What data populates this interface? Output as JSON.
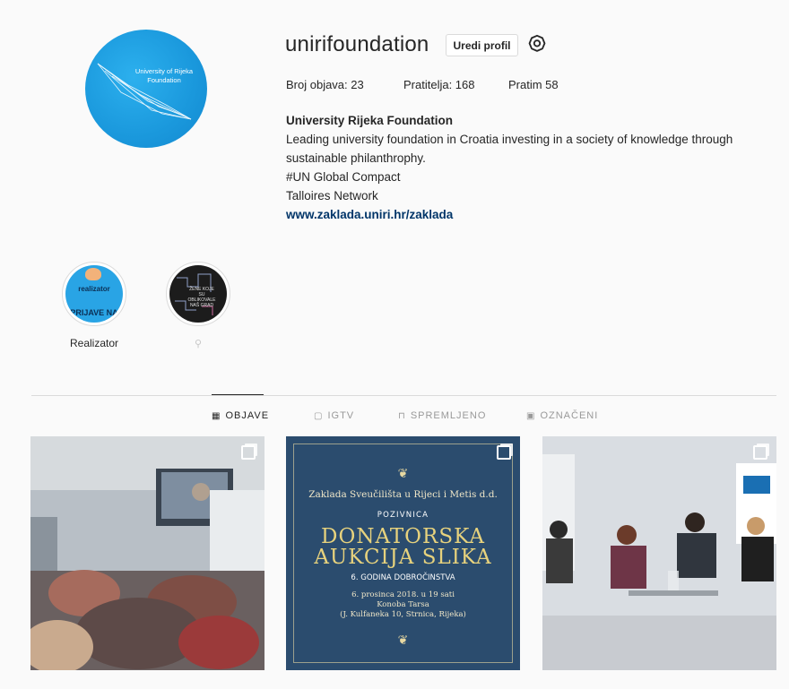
{
  "profile": {
    "username": "unirifoundation",
    "edit_button": "Uredi profil",
    "avatar_text": "University of Rijeka Foundation",
    "stats": {
      "posts": "Broj objava: 23",
      "followers": "Pratitelja: 168",
      "following": "Pratim 58"
    },
    "bio": {
      "name": "University Rijeka Foundation",
      "line1": "Leading university foundation in Croatia investing in a society of knowledge through",
      "line2": "sustainable philanthrophy.",
      "line3": "#UN Global Compact",
      "line4": "Talloires Network",
      "link": "www.zaklada.uniri.hr/zaklada"
    }
  },
  "highlights": [
    {
      "label": "Realizator",
      "img_text_top": "realizator",
      "img_text_bottom": "PRIJAVE NA"
    },
    {
      "label": "",
      "img_text": "ŽENE KOJE SU OBLIKOVALE NAŠ GRAD",
      "pin_icon": "pin-icon"
    }
  ],
  "tabs": [
    {
      "label": "OBJAVE",
      "icon": "grid-icon",
      "active": true
    },
    {
      "label": "IGTV",
      "icon": "tv-icon",
      "active": false
    },
    {
      "label": "SPREMLJENO",
      "icon": "bookmark-icon",
      "active": false
    },
    {
      "label": "OZNAČENI",
      "icon": "tag-icon",
      "active": false
    }
  ],
  "posts": {
    "poster": {
      "org": "Zaklada Sveučilišta u Rijeci i Metis d.d.",
      "invite": "POZIVNICA",
      "title1": "DONATORSKA",
      "title2": "AUKCIJA SLIKA",
      "year": "6. GODINA DOBROČINSTVA",
      "date1": "6. prosinca 2018. u 19 sati",
      "date2": "Konoba Tarsa",
      "date3": "(J. Kulfaneka 10, Strnica, Rijeka)"
    }
  },
  "colors": {
    "link": "#003569",
    "avatar": "#1a98dc",
    "poster_bg": "#2b4c6e",
    "poster_gold": "#e7d27d"
  }
}
